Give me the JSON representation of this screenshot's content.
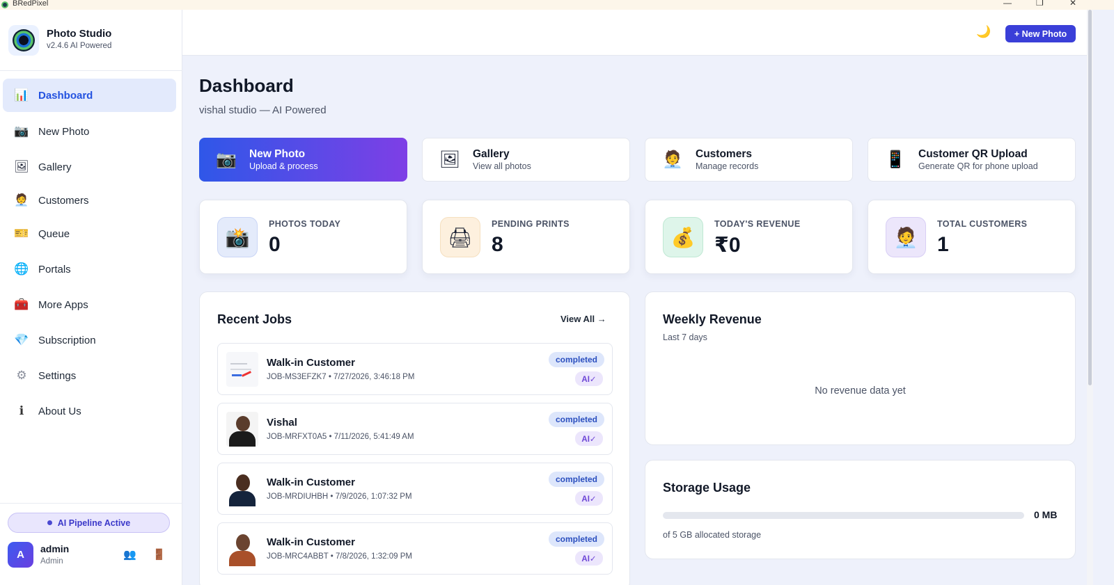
{
  "window": {
    "title": "BRedPixel",
    "minimize": "—",
    "restore": "❐",
    "close": "✕"
  },
  "brand": {
    "title": "Photo Studio",
    "subtitle": "v2.4.6 AI Powered"
  },
  "sidebar": {
    "items": [
      {
        "label": "Dashboard",
        "icon": "bar-chart-icon",
        "glyph": "📊",
        "active": true
      },
      {
        "label": "New Photo",
        "icon": "camera-icon",
        "glyph": "📷"
      },
      {
        "label": "Gallery",
        "icon": "picture-icon",
        "glyph": "🖼"
      },
      {
        "label": "Customers",
        "icon": "client-icon",
        "glyph": "🧑‍💼"
      },
      {
        "label": "Queue",
        "icon": "ticket-icon",
        "glyph": "🎫"
      },
      {
        "label": "Portals",
        "icon": "globe-icon",
        "glyph": "🌐"
      },
      {
        "label": "More Apps",
        "icon": "toolbox-icon",
        "glyph": "🧰"
      },
      {
        "label": "Subscription",
        "icon": "diamond-icon",
        "glyph": "💎"
      },
      {
        "label": "Settings",
        "icon": "gear-icon",
        "glyph": "⚙"
      },
      {
        "label": "About Us",
        "icon": "info-icon",
        "glyph": "ℹ"
      }
    ],
    "pipeline": "AI Pipeline Active",
    "user": {
      "initial": "A",
      "name": "admin",
      "role": "Admin"
    }
  },
  "header": {
    "theme_glyph": "🌙",
    "new_photo_button": "+ New Photo"
  },
  "page": {
    "title": "Dashboard",
    "subtitle": "vishal studio — AI Powered"
  },
  "quick_actions": [
    {
      "title": "New Photo",
      "subtitle": "Upload & process",
      "glyph": "📷"
    },
    {
      "title": "Gallery",
      "subtitle": "View all photos",
      "glyph": "🖼"
    },
    {
      "title": "Customers",
      "subtitle": "Manage records",
      "glyph": "🧑‍💼"
    },
    {
      "title": "Customer QR Upload",
      "subtitle": "Generate QR for phone upload",
      "glyph": "📱"
    }
  ],
  "stats": [
    {
      "label": "PHOTOS TODAY",
      "value": "0",
      "glyph": "📸",
      "bg": "#e4ebfb"
    },
    {
      "label": "PENDING PRINTS",
      "value": "8",
      "glyph": "🖨",
      "bg": "#fdf0de"
    },
    {
      "label": "TODAY'S REVENUE",
      "value": "₹0",
      "glyph": "💰",
      "bg": "#def5ea"
    },
    {
      "label": "TOTAL CUSTOMERS",
      "value": "1",
      "glyph": "🧑‍💼",
      "bg": "#ece6fb"
    }
  ],
  "recent_jobs": {
    "title": "Recent Jobs",
    "view_all": "View All →",
    "jobs": [
      {
        "name": "Walk-in Customer",
        "meta": "JOB-MS3EFZK7 • 7/27/2026, 3:46:18 PM",
        "status": "completed",
        "ai": "AI✓"
      },
      {
        "name": "Vishal",
        "meta": "JOB-MRFXT0A5 • 7/11/2026, 5:41:49 AM",
        "status": "completed",
        "ai": "AI✓"
      },
      {
        "name": "Walk-in Customer",
        "meta": "JOB-MRDIUHBH • 7/9/2026, 1:07:32 PM",
        "status": "completed",
        "ai": "AI✓"
      },
      {
        "name": "Walk-in Customer",
        "meta": "JOB-MRC4ABBT • 7/8/2026, 1:32:09 PM",
        "status": "completed",
        "ai": "AI✓"
      }
    ]
  },
  "weekly_revenue": {
    "title": "Weekly Revenue",
    "subtitle": "Last 7 days",
    "empty": "No revenue data yet"
  },
  "storage": {
    "title": "Storage Usage",
    "value": "0 MB",
    "subtitle": "of 5 GB allocated storage",
    "used_fraction": 0
  },
  "colors": {
    "accent": "#3a3fd8",
    "active_nav_bg": "#e3eafc",
    "active_nav_text": "#2352e0"
  }
}
